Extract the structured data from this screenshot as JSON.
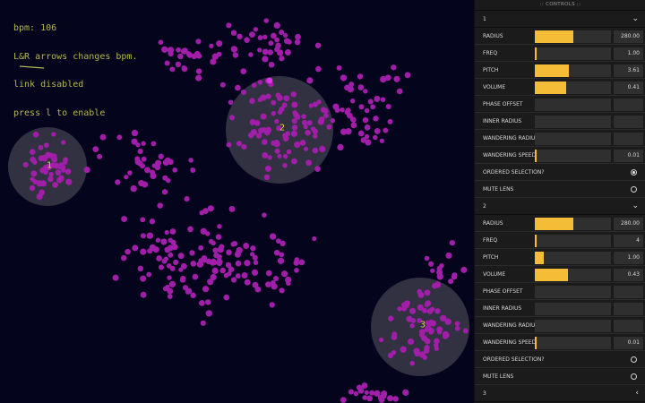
{
  "hud": {
    "bpm": "bpm: 106",
    "arrows": "L&R arrows changes bpm.",
    "link": "link disabled",
    "press": "press l to enable"
  },
  "colors": {
    "background": "#04041c",
    "particle": "#a01ea8",
    "particle_highlight": "#e030e8",
    "lens": "#3a3a48",
    "accent": "#f4bd37",
    "hud_text": "#b6b650"
  },
  "lenses": [
    {
      "label": "1"
    },
    {
      "label": "2"
    },
    {
      "label": "3"
    }
  ],
  "controls": {
    "title": ":: CONTROLS ::",
    "lens1": {
      "folder": "1",
      "radius": {
        "label": "RADIUS",
        "value": "280.00",
        "level": 0.5
      },
      "freq": {
        "label": "FREQ",
        "value": "1.00",
        "level": 0.0
      },
      "pitch": {
        "label": "PITCH",
        "value": "3.61",
        "level": 0.45
      },
      "volume": {
        "label": "VOLUME",
        "value": "0.41",
        "level": 0.41
      },
      "phase_offset": {
        "label": "PHASE OFFSET",
        "value": ""
      },
      "inner_radius": {
        "label": "INNER RADIUS",
        "value": ""
      },
      "wandering_radius": {
        "label": "WANDERING RADIUS",
        "value": ""
      },
      "wandering_speed": {
        "label": "WANDERING SPEED",
        "value": "0.01",
        "level": 0.01
      },
      "ordered_selection": {
        "label": "ORDERED SELECTION?",
        "checked": true
      },
      "mute_lens": {
        "label": "MUTE LENS",
        "checked": false
      }
    },
    "lens2": {
      "folder": "2",
      "radius": {
        "label": "RADIUS",
        "value": "280.00",
        "level": 0.5
      },
      "freq": {
        "label": "FREQ",
        "value": "4",
        "level": 0.02
      },
      "pitch": {
        "label": "PITCH",
        "value": "1.00",
        "level": 0.12
      },
      "volume": {
        "label": "VOLUME",
        "value": "0.43",
        "level": 0.43
      },
      "phase_offset": {
        "label": "PHASE OFFSET",
        "value": ""
      },
      "inner_radius": {
        "label": "INNER RADIUS",
        "value": ""
      },
      "wandering_radius": {
        "label": "WANDERING RADIUS",
        "value": ""
      },
      "wandering_speed": {
        "label": "WANDERING SPEED",
        "value": "0.01",
        "level": 0.01
      },
      "ordered_selection": {
        "label": "ORDERED SELECTION?",
        "checked": false
      },
      "mute_lens": {
        "label": "MUTE LENS",
        "checked": false
      }
    },
    "lens3": {
      "folder": "3"
    }
  }
}
